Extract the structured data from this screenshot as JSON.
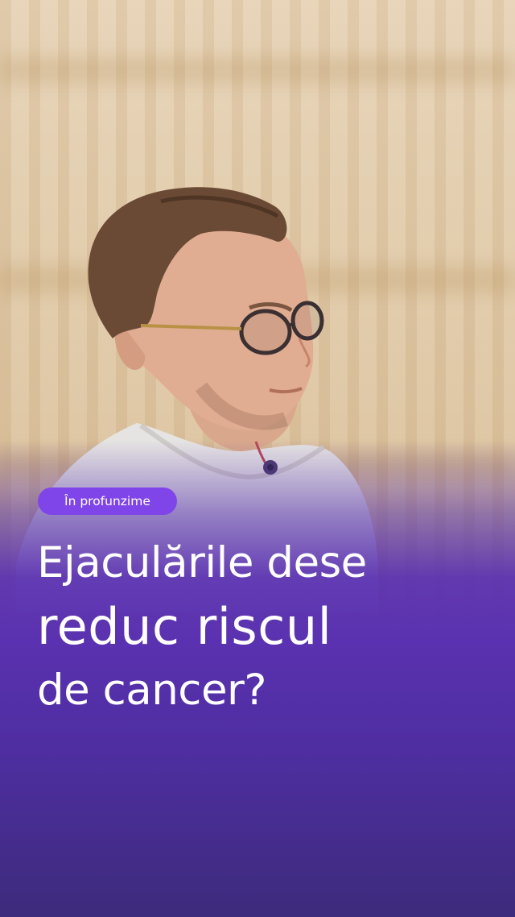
{
  "badge": {
    "label": "În profunzime"
  },
  "headline": {
    "line1": "Ejaculările dese",
    "line2": "reduc riscul",
    "line3": "de cancer?"
  },
  "colors": {
    "badge_bg": "#7f45e8",
    "overlay_purple": "#5a31b0",
    "text": "#ffffff"
  }
}
